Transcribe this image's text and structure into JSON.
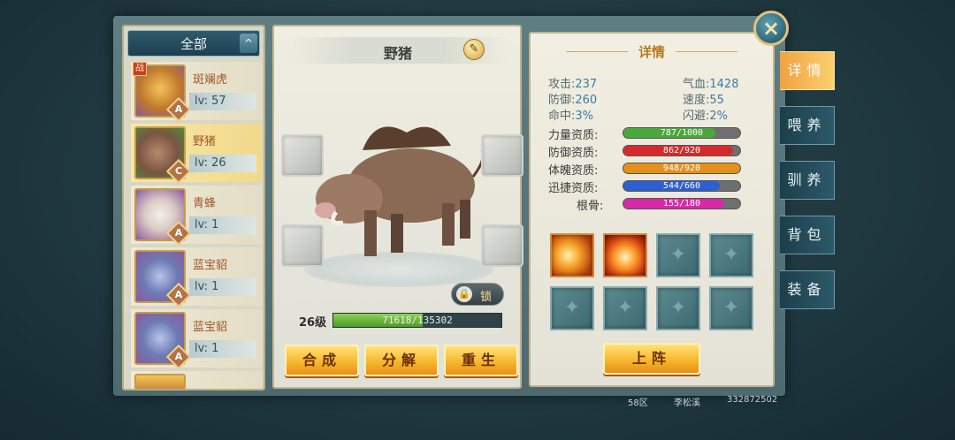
{
  "list": {
    "filter_label": "全部",
    "collapse_icon": "^",
    "pets": [
      {
        "name": "斑斓虎",
        "level": "lv: 57",
        "rank": "A",
        "badge": "战",
        "selected": false
      },
      {
        "name": "野猪",
        "level": "lv: 26",
        "rank": "C",
        "badge": "",
        "selected": true
      },
      {
        "name": "青蜂",
        "level": "lv: 1",
        "rank": "A",
        "badge": "",
        "selected": false
      },
      {
        "name": "蓝宝貂",
        "level": "lv: 1",
        "rank": "A",
        "badge": "",
        "selected": false
      },
      {
        "name": "蓝宝貂",
        "level": "lv: 1",
        "rank": "A",
        "badge": "",
        "selected": false
      }
    ]
  },
  "pet_view": {
    "name": "野猪",
    "lock_label": "锁",
    "level_label": "26级",
    "exp_text": "71618/135302",
    "exp_fraction": 0.529,
    "actions": {
      "combine": "合成",
      "decompose": "分解",
      "rebirth": "重生"
    }
  },
  "details": {
    "title": "详情",
    "stats": {
      "attack_label": "攻击:",
      "attack": "237",
      "hp_label": "气血:",
      "hp": "1428",
      "defense_label": "防御:",
      "defense": "260",
      "speed_label": "速度:",
      "speed": "55",
      "hit_label": "命中:",
      "hit": "3%",
      "dodge_label": "闪避:",
      "dodge": "2%"
    },
    "aptitudes": [
      {
        "label": "力量资质:",
        "text": "787/1000",
        "fraction": 0.787,
        "color": "#4aa83a"
      },
      {
        "label": "防御资质:",
        "text": "862/920",
        "fraction": 0.937,
        "color": "#d62a2a"
      },
      {
        "label": "体魄资质:",
        "text": "948/920",
        "fraction": 1.0,
        "color": "#e6901c"
      },
      {
        "label": "迅捷资质:",
        "text": "544/660",
        "fraction": 0.824,
        "color": "#2d5fd0"
      },
      {
        "label": "根骨:",
        "text": "155/180",
        "fraction": 0.861,
        "color": "#d62aa8"
      }
    ],
    "deploy_label": "上阵"
  },
  "side_tabs": [
    "详情",
    "喂养",
    "驯养",
    "背包",
    "装备"
  ],
  "close_icon": "×",
  "footer": {
    "server": "58区",
    "player": "李松溪",
    "id": "332872502"
  }
}
